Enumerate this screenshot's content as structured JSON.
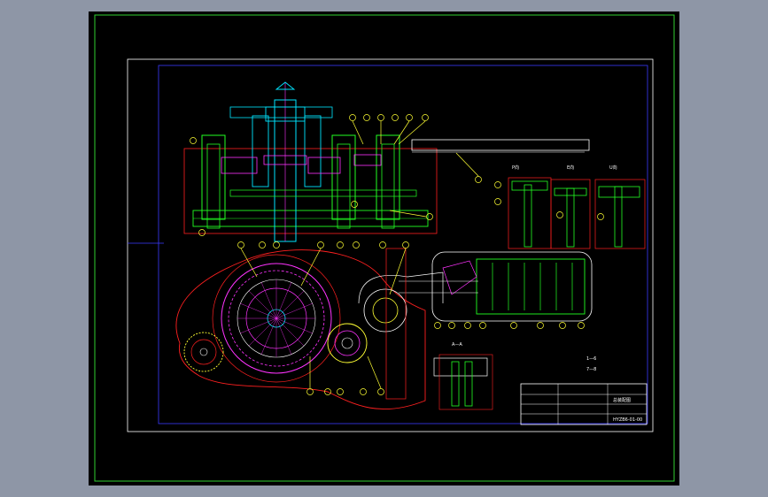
{
  "colors": {
    "background": "#8e96a6",
    "paper": "#000000",
    "sheet_border": "#2fd12f",
    "title_border": "#ffffff",
    "inner_border": "#3a3aff",
    "outline": "#ff2020",
    "part": "#22ff22",
    "shaft": "#00e5ff",
    "accent": "#ff33ff",
    "callout": "#ffff33",
    "dim": "#ffffff"
  },
  "view_labels": {
    "view_p": "P向",
    "view_e": "E向",
    "view_u": "U向",
    "section_aa": "A—A"
  },
  "title_block": {
    "name": "总装配图",
    "drawing_number": "HYZB6-01-00"
  },
  "legend": {
    "item1": "1—6",
    "item2": "7—8"
  }
}
